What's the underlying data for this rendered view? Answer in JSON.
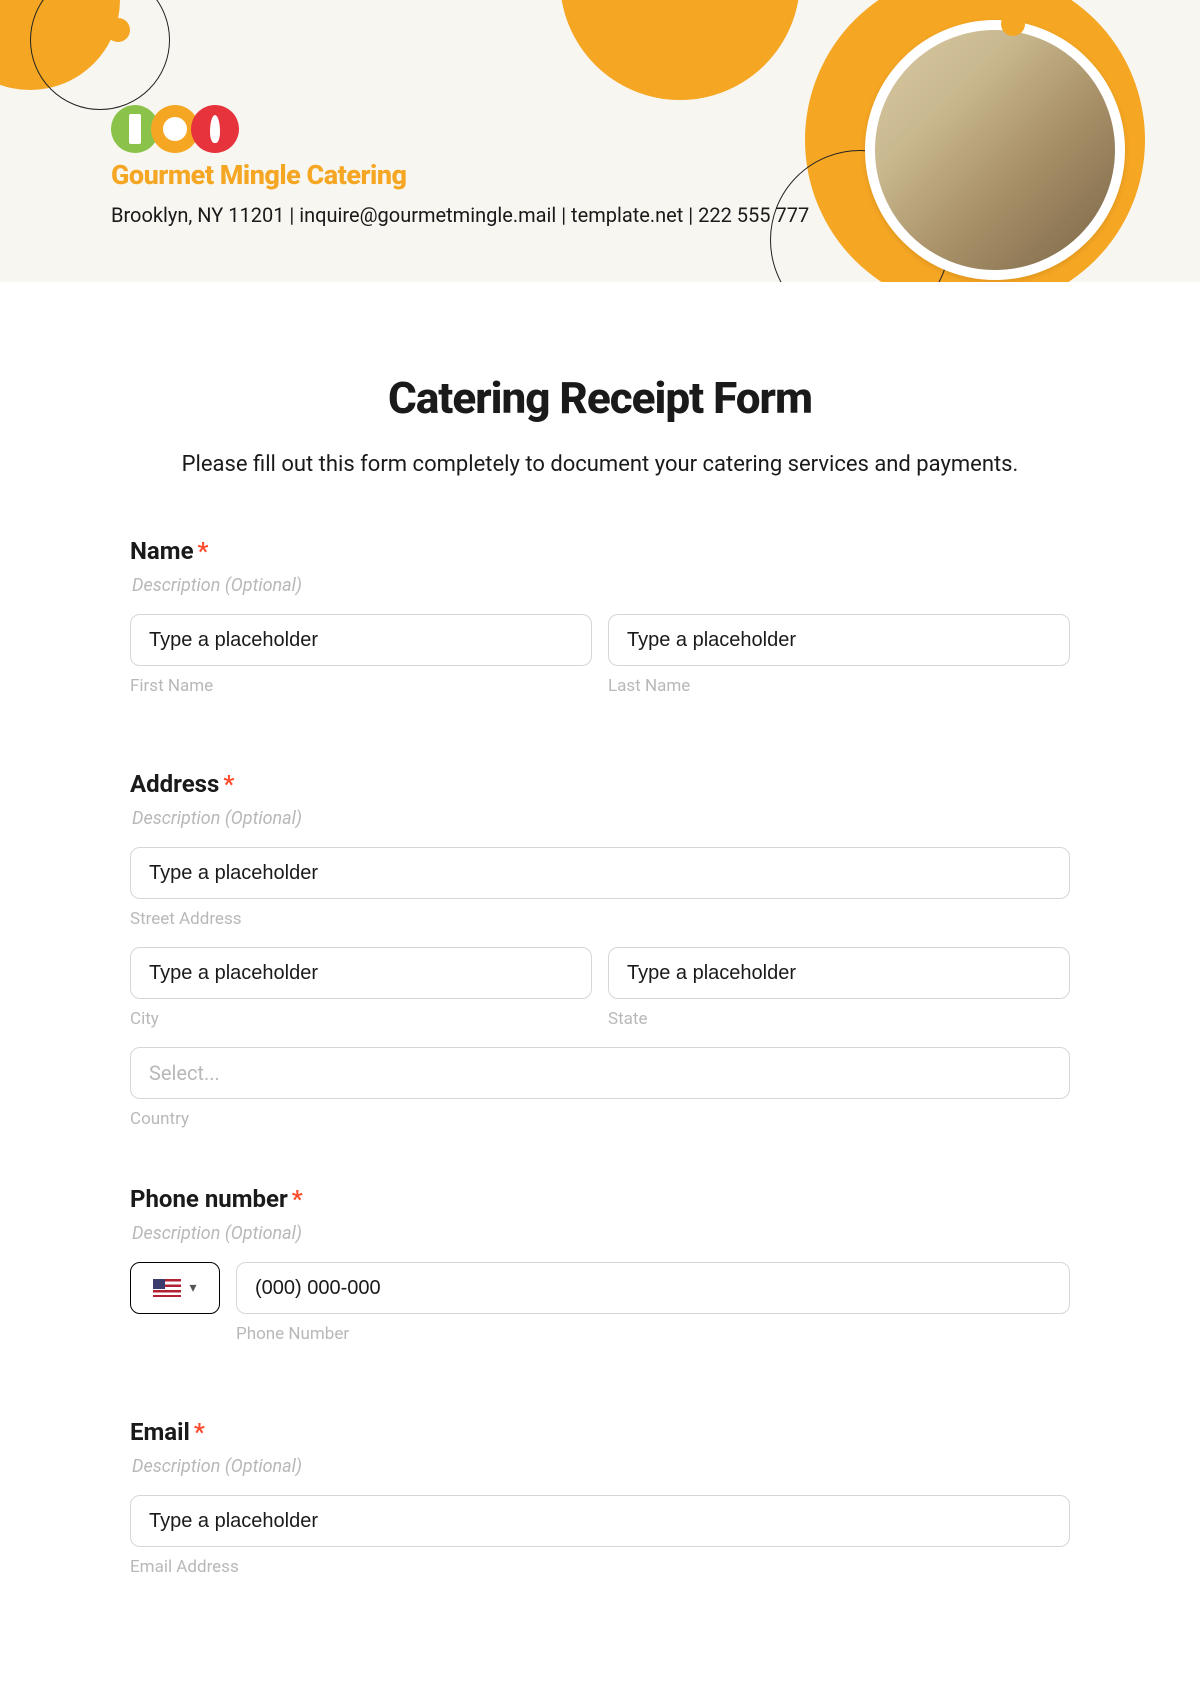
{
  "header": {
    "company_name": "Gourmet Mingle Catering",
    "contact_line": "Brooklyn, NY 11201 | inquire@gourmetmingle.mail | template.net | 222 555 777"
  },
  "form": {
    "title": "Catering Receipt Form",
    "subtitle": "Please fill out this form completely to document your catering services and payments."
  },
  "fields": {
    "name": {
      "label": "Name",
      "required": "*",
      "description": "Description (Optional)",
      "first_placeholder": "Type a placeholder",
      "first_sublabel": "First Name",
      "last_placeholder": "Type a placeholder",
      "last_sublabel": "Last Name"
    },
    "address": {
      "label": "Address",
      "required": "*",
      "description": "Description (Optional)",
      "street_placeholder": "Type a placeholder",
      "street_sublabel": "Street Address",
      "city_placeholder": "Type a placeholder",
      "city_sublabel": "City",
      "state_placeholder": "Type a placeholder",
      "state_sublabel": "State",
      "country_placeholder": "Select...",
      "country_sublabel": "Country"
    },
    "phone": {
      "label": "Phone number",
      "required": "*",
      "description": "Description (Optional)",
      "placeholder": "(000) 000-000",
      "sublabel": "Phone Number"
    },
    "email": {
      "label": "Email",
      "required": "*",
      "description": "Description (Optional)",
      "placeholder": "Type a placeholder",
      "sublabel": "Email Address"
    }
  }
}
